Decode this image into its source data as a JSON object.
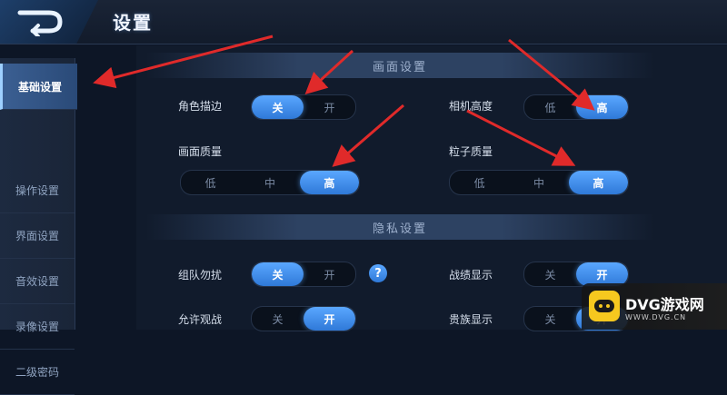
{
  "header": {
    "title": "设置"
  },
  "sidebar": {
    "items": [
      {
        "label": "基础设置"
      },
      {
        "label": "操作设置"
      },
      {
        "label": "界面设置"
      },
      {
        "label": "音效设置"
      },
      {
        "label": "录像设置"
      },
      {
        "label": "二级密码"
      }
    ],
    "active": 0
  },
  "sections": {
    "display": {
      "title": "画面设置"
    },
    "privacy": {
      "title": "隐私设置"
    }
  },
  "settings": {
    "outline": {
      "label": "角色描边",
      "options": [
        "关",
        "开"
      ],
      "selected": 0
    },
    "camera": {
      "label": "相机高度",
      "options": [
        "低",
        "高"
      ],
      "selected": 1
    },
    "quality": {
      "label": "画面质量",
      "options": [
        "低",
        "中",
        "高"
      ],
      "selected": 2
    },
    "particles": {
      "label": "粒子质量",
      "options": [
        "低",
        "中",
        "高"
      ],
      "selected": 2
    },
    "team_dnd": {
      "label": "组队勿扰",
      "options": [
        "关",
        "开"
      ],
      "selected": 0
    },
    "record": {
      "label": "战绩显示",
      "options": [
        "关",
        "开"
      ],
      "selected": 1
    },
    "watch": {
      "label": "允许观战",
      "options": [
        "关",
        "开"
      ],
      "selected": 1
    },
    "nobility": {
      "label": "贵族显示",
      "options": [
        "关",
        "开"
      ],
      "selected": 1
    }
  },
  "help_icon": {
    "glyph": "?"
  },
  "watermark": {
    "brand": "DVG游戏网",
    "url": "WWW.DVG.CN"
  },
  "colors": {
    "accent": "#3b8cf0",
    "annotation_arrow": "#e02a2a",
    "watermark_yellow": "#f6c81f"
  },
  "icons": {
    "back": "back-arrow-icon",
    "help": "question-icon"
  }
}
